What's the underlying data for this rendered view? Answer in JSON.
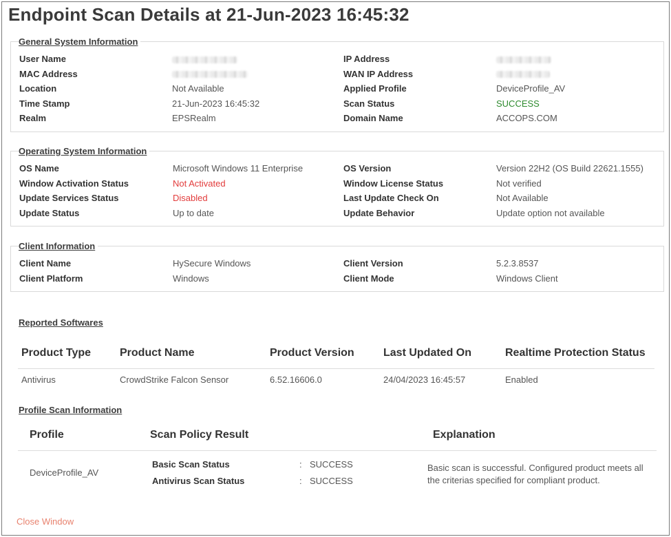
{
  "title": "Endpoint Scan Details at 21-Jun-2023 16:45:32",
  "general": {
    "legend": "General System Information",
    "user_name_label": "User Name",
    "mac_label": "MAC Address",
    "location_label": "Location",
    "location_value": "Not Available",
    "timestamp_label": "Time Stamp",
    "timestamp_value": "21-Jun-2023 16:45:32",
    "realm_label": "Realm",
    "realm_value": "EPSRealm",
    "ip_label": "IP Address",
    "wan_ip_label": "WAN IP Address",
    "profile_label": "Applied Profile",
    "profile_value": "DeviceProfile_AV",
    "scan_status_label": "Scan Status",
    "scan_status_value": "SUCCESS",
    "domain_label": "Domain Name",
    "domain_value": "ACCOPS.COM"
  },
  "os": {
    "legend": "Operating System Information",
    "os_name_label": "OS Name",
    "os_name_value": "Microsoft Windows 11 Enterprise",
    "activation_label": "Window Activation Status",
    "activation_value": "Not Activated",
    "update_services_label": "Update Services Status",
    "update_services_value": "Disabled",
    "update_status_label": "Update Status",
    "update_status_value": "Up to date",
    "os_version_label": "OS Version",
    "os_version_value": "Version 22H2 (OS Build 22621.1555)",
    "license_label": "Window License Status",
    "license_value": "Not verified",
    "last_update_label": "Last Update Check On",
    "last_update_value": "Not Available",
    "update_behavior_label": "Update Behavior",
    "update_behavior_value": "Update option not available"
  },
  "client": {
    "legend": "Client Information",
    "name_label": "Client Name",
    "name_value": "HySecure Windows",
    "platform_label": "Client Platform",
    "platform_value": "Windows",
    "version_label": "Client Version",
    "version_value": "5.2.3.8537",
    "mode_label": "Client Mode",
    "mode_value": "Windows Client"
  },
  "softwares": {
    "heading": "Reported Softwares",
    "columns": [
      "Product Type",
      "Product Name",
      "Product Version",
      "Last Updated On",
      "Realtime Protection Status"
    ],
    "rows": [
      [
        "Antivirus",
        "CrowdStrike Falcon Sensor",
        "6.52.16606.0",
        "24/04/2023 16:45:57",
        "Enabled"
      ]
    ]
  },
  "profile_scan": {
    "heading": "Profile Scan Information",
    "columns": [
      "Profile",
      "Scan Policy Result",
      "Explanation"
    ],
    "profile": "DeviceProfile_AV",
    "results": [
      {
        "label": "Basic Scan Status",
        "sep": ":",
        "value": "SUCCESS"
      },
      {
        "label": "Antivirus Scan Status",
        "sep": ":",
        "value": "SUCCESS"
      }
    ],
    "explanation": "Basic scan is successful. Configured product meets all the criterias specified for compliant product."
  },
  "close_label": "Close Window",
  "colors": {
    "success": "#2e8b2e",
    "error": "#e23b3b",
    "link": "#e8826e"
  }
}
